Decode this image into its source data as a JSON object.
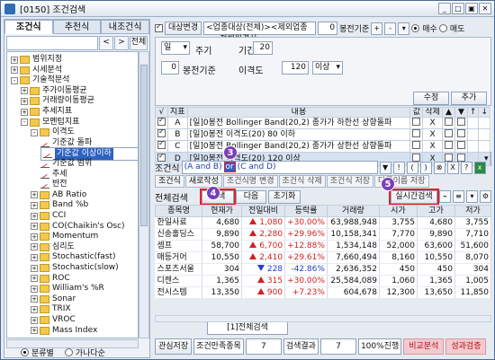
{
  "title": "[0150] 조건검색",
  "title_buttons": [
    "_",
    "□",
    "▣",
    "✕"
  ],
  "left": {
    "tabs": [
      "조건식",
      "추천식",
      "내조건식"
    ],
    "nav": [
      "<",
      ">",
      "전체"
    ],
    "tree": [
      {
        "level": 0,
        "type": "folder",
        "pm": "+",
        "label": "범위지정"
      },
      {
        "level": 0,
        "type": "folder",
        "pm": "+",
        "label": "시세분석"
      },
      {
        "level": 0,
        "type": "folder",
        "pm": "-",
        "label": "기술적분석"
      },
      {
        "level": 1,
        "type": "folder",
        "pm": "+",
        "label": "주가이동평균"
      },
      {
        "level": 1,
        "type": "folder",
        "pm": "+",
        "label": "거래량이동평균"
      },
      {
        "level": 1,
        "type": "folder",
        "pm": "+",
        "label": "추세지표"
      },
      {
        "level": 1,
        "type": "folder",
        "pm": "-",
        "label": "모멘텀지표"
      },
      {
        "level": 2,
        "type": "folder",
        "pm": "-",
        "label": "이격도"
      },
      {
        "level": 3,
        "type": "doc",
        "label": "기준값 돌파"
      },
      {
        "level": 3,
        "type": "doc",
        "label": "기준값 이상이하",
        "selected": true
      },
      {
        "level": 3,
        "type": "doc",
        "label": "기준값 범위"
      },
      {
        "level": 3,
        "type": "doc",
        "label": "추세"
      },
      {
        "level": 3,
        "type": "doc",
        "label": "반전"
      },
      {
        "level": 2,
        "type": "folder",
        "pm": "+",
        "label": "AB Ratio"
      },
      {
        "level": 2,
        "type": "folder",
        "pm": "+",
        "label": "Band %b"
      },
      {
        "level": 2,
        "type": "folder",
        "pm": "+",
        "label": "CCI"
      },
      {
        "level": 2,
        "type": "folder",
        "pm": "+",
        "label": "CO(Chaikin's Osc)"
      },
      {
        "level": 2,
        "type": "folder",
        "pm": "+",
        "label": "Momentum"
      },
      {
        "level": 2,
        "type": "folder",
        "pm": "+",
        "label": "심리도"
      },
      {
        "level": 2,
        "type": "folder",
        "pm": "+",
        "label": "Stochastic(fast)"
      },
      {
        "level": 2,
        "type": "folder",
        "pm": "+",
        "label": "Stochastic(slow)"
      },
      {
        "level": 2,
        "type": "folder",
        "pm": "+",
        "label": "ROC"
      },
      {
        "level": 2,
        "type": "folder",
        "pm": "+",
        "label": "William's %R"
      },
      {
        "level": 2,
        "type": "folder",
        "pm": "+",
        "label": "Sonar"
      },
      {
        "level": 2,
        "type": "folder",
        "pm": "+",
        "label": "TRIX"
      },
      {
        "level": 2,
        "type": "folder",
        "pm": "+",
        "label": "VROC"
      },
      {
        "level": 2,
        "type": "folder",
        "pm": "+",
        "label": "Mass Index"
      }
    ],
    "radio_a": "분류별",
    "radio_b": "가나다순"
  },
  "top": {
    "target_label": "대상변경",
    "target_value": "<업종대상(전체)><제외업종><전체월결산>",
    "spin_value": "0",
    "bong_label": "봉전기준",
    "buy_label": "매수",
    "sell_label": "매도"
  },
  "setting": {
    "period_unit": "일",
    "period_type": "주기",
    "offset_value": "0",
    "offset_label": "봉전기준",
    "term_label": "기간",
    "term_value": "20",
    "disp_label": "이격도",
    "disp_value": "120",
    "disp_cmp": "이상",
    "btn_modify": "수정",
    "btn_add": "추가"
  },
  "conditions": {
    "headers": [
      "√",
      "지표",
      "내용",
      "값",
      "삭제",
      "▲",
      "▼",
      "↑",
      "↓"
    ],
    "rows": [
      {
        "check": true,
        "id": "A",
        "text": "[일]0봉전 Bollinger Band(20,2) 종가가 하한선 상향돌파",
        "del": "X"
      },
      {
        "check": true,
        "id": "B",
        "text": "[일]0봉전 이격도(20) 80 이하",
        "del": "X"
      },
      {
        "check": true,
        "id": "C",
        "text": "[일]0봉전 Bollinger Band(20,2) 종가가 상한선 상향돌파",
        "del": "X"
      },
      {
        "check": true,
        "id": "D",
        "text": "[일]0봉전 이격도(20) 120 이상",
        "del": "X",
        "selected": true
      }
    ]
  },
  "formula": {
    "label": "조건식",
    "part1": "(A and B)",
    "op": "or",
    "part2": "(C and D)",
    "ops": [
      "▼",
      "!",
      "(",
      ")",
      "⊗",
      "X",
      "?"
    ]
  },
  "row2": {
    "label": "조건식",
    "b1": "새로작성",
    "b2": "조건식명 변경",
    "b3": "조건식 삭제",
    "b4": "조건식 저장",
    "b5": "다른이름 저장"
  },
  "search": {
    "title": "전체검색",
    "btn_search": "검색",
    "btn_next": "다음",
    "btn_reset": "초기화",
    "btn_realtime": "실시간검색"
  },
  "results": {
    "headers": [
      "종목명",
      "현재가",
      "전일대비",
      "등락률",
      "거래량",
      "시가",
      "고가",
      "저가"
    ],
    "rows": [
      {
        "name": "한일사료",
        "price": "4,680",
        "dir": "up",
        "chg": "1,080",
        "rate": "+30.00%",
        "vol": "63,988,948",
        "open": "3,755",
        "high": "4,680",
        "low": "3,755"
      },
      {
        "name": "신송홀딩스",
        "price": "9,890",
        "dir": "up",
        "chg": "2,280",
        "rate": "+29.96%",
        "vol": "10,158,341",
        "open": "7,770",
        "high": "9,890",
        "low": "7,710"
      },
      {
        "name": "셈프",
        "price": "58,700",
        "dir": "up",
        "chg": "6,700",
        "rate": "+12.88%",
        "vol": "1,534,148",
        "open": "52,000",
        "high": "63,600",
        "low": "51,600"
      },
      {
        "name": "매등거어",
        "price": "10,550",
        "dir": "up",
        "chg": "2,410",
        "rate": "+29.61%",
        "vol": "7,660,494",
        "open": "8,160",
        "high": "10,550",
        "low": "8,070"
      },
      {
        "name": "스포츠서울",
        "price": "304",
        "dir": "dn",
        "chg": "228",
        "rate": "-42.86%",
        "vol": "2,636,352",
        "open": "450",
        "high": "450",
        "low": "304"
      },
      {
        "name": "디젠스",
        "price": "1,365",
        "dir": "up",
        "chg": "315",
        "rate": "+30.00%",
        "vol": "25,584,089",
        "open": "1,060",
        "high": "1,365",
        "low": "1,005"
      },
      {
        "name": "전시스템",
        "price": "13,350",
        "dir": "up",
        "chg": "900",
        "rate": "+7.23%",
        "vol": "604,678",
        "open": "12,300",
        "high": "13,650",
        "low": "11,850"
      }
    ]
  },
  "bottom_tab": "[1]전체검색",
  "status": {
    "btn_save": "관심저장",
    "lbl_count": "조건만족종목",
    "count": "7",
    "lbl_result": "검색결과",
    "result": "7",
    "progress": "100%진행",
    "btn_compare": "비교분석",
    "btn_verify": "성과검증"
  },
  "markers": [
    "3",
    "4",
    "5"
  ]
}
